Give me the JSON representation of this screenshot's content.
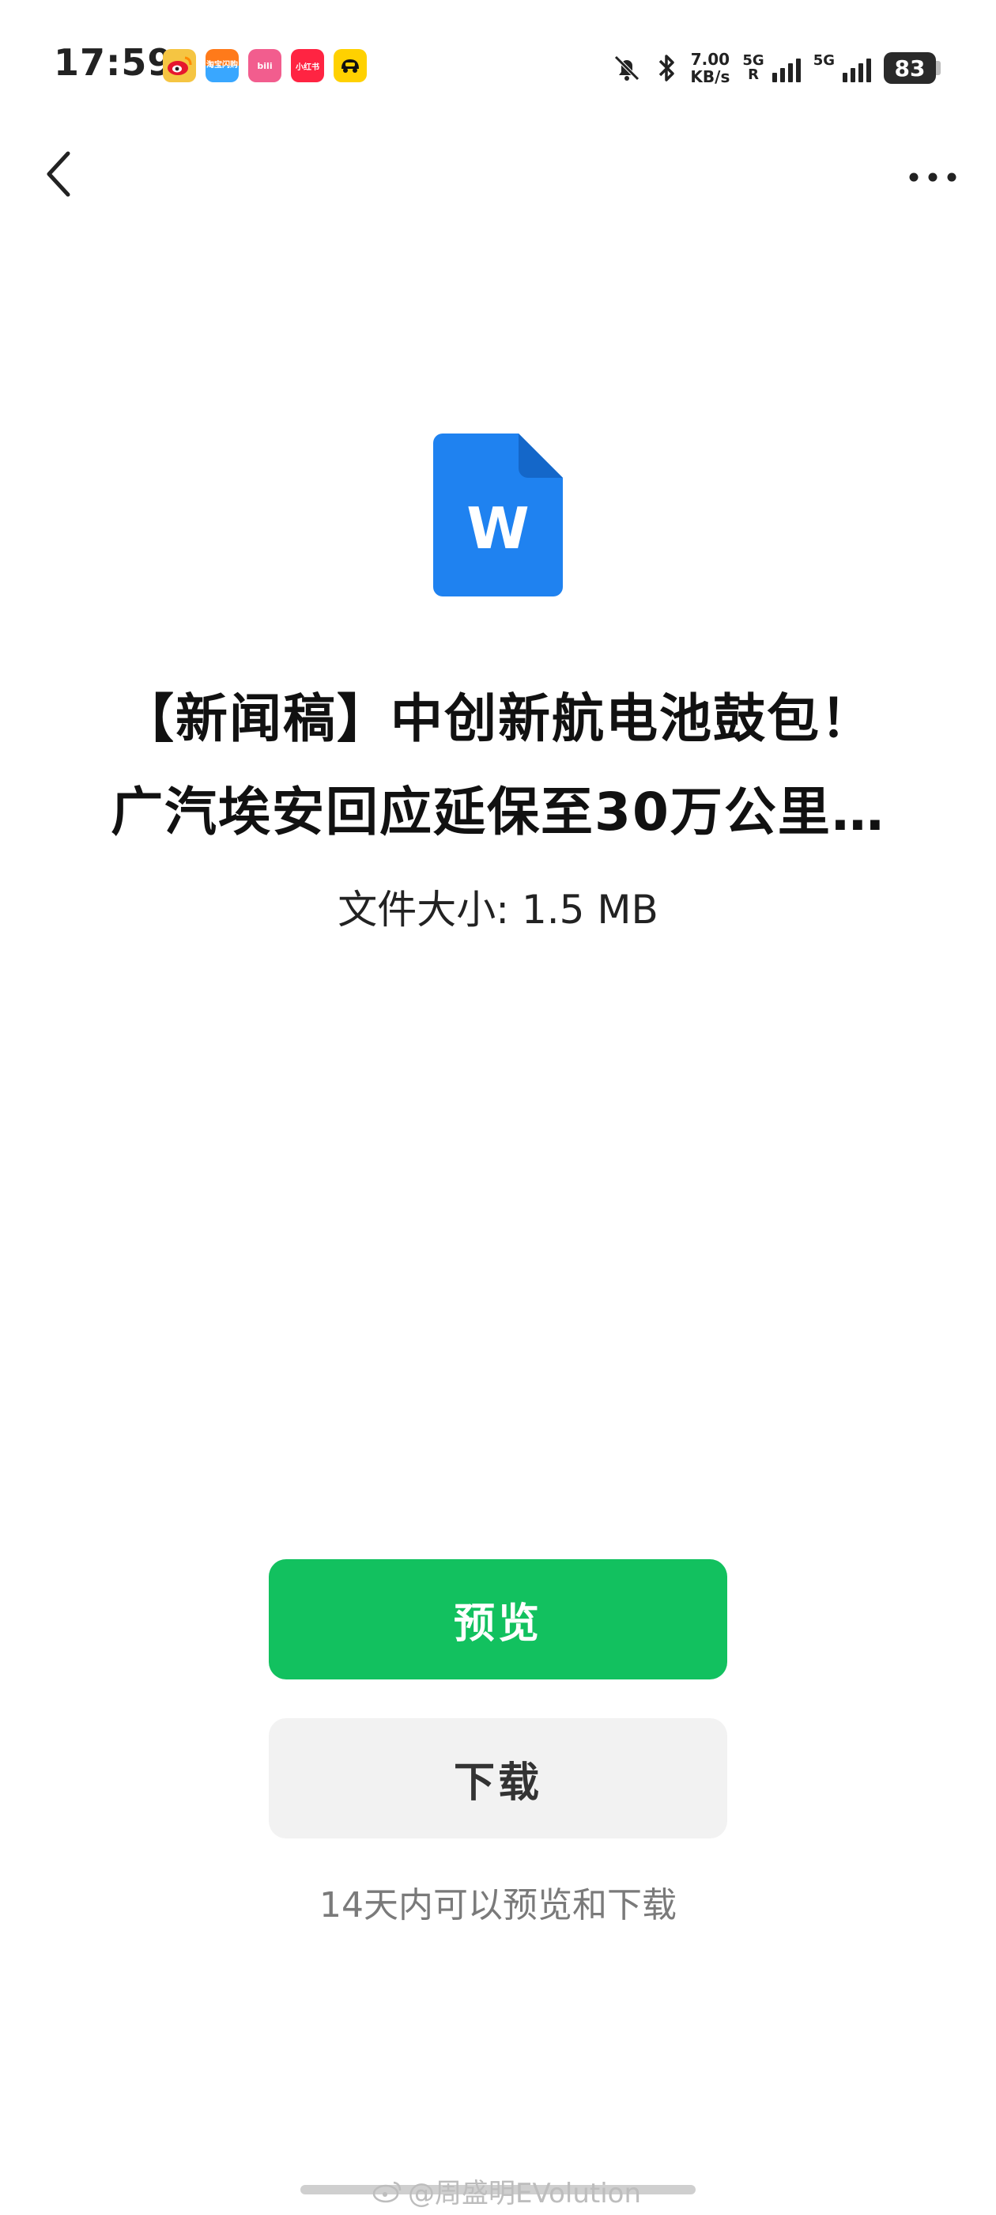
{
  "status_bar": {
    "time": "17:59",
    "app_icons": [
      {
        "name": "weibo-icon",
        "label": ""
      },
      {
        "name": "taobao-flash-icon",
        "label": "淘宝闪购"
      },
      {
        "name": "bilibili-icon",
        "label": "bili"
      },
      {
        "name": "xiaohongshu-icon",
        "label": "小红书"
      },
      {
        "name": "car-app-icon",
        "label": ""
      }
    ],
    "speed_value": "7.00",
    "speed_unit": "KB/s",
    "sim1_label": "5G",
    "sim1_roaming": "R",
    "sim2_label": "5G",
    "battery_level": "83"
  },
  "file": {
    "icon_letter": "W",
    "icon_color": "#1f82f0",
    "title_line1": "【新闻稿】中创新航电池鼓包！",
    "title_line2": "广汽埃安回应延保至30万公里…",
    "size_text": "文件大小: 1.5 MB"
  },
  "actions": {
    "preview_label": "预览",
    "download_label": "下载",
    "preview_color": "#12c15f",
    "hint": "14天内可以预览和下载"
  },
  "watermark": "@周盛明EVolution"
}
